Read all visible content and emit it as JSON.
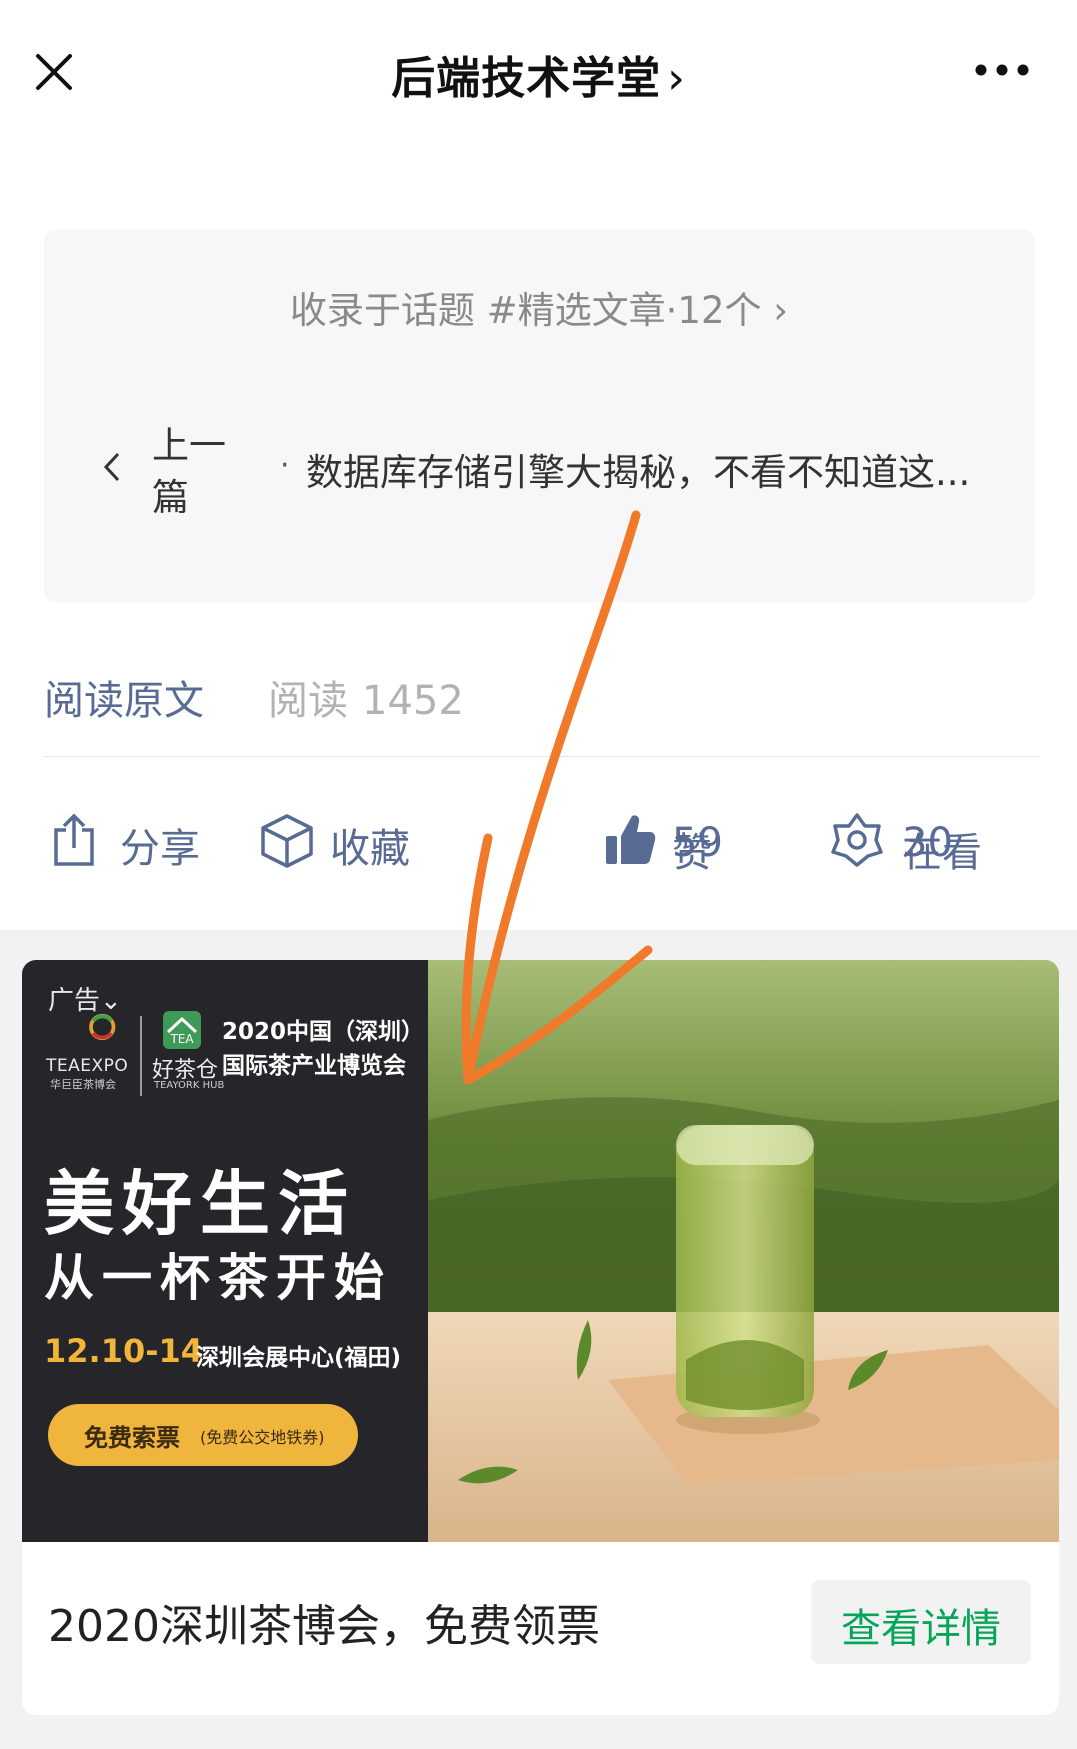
{
  "header": {
    "title": "后端技术学堂",
    "title_chevron": "›"
  },
  "topic_card": {
    "topic_line": "收录于话题 #精选文章·12个 ›",
    "prev_label": "上一篇",
    "prev_dot": "·",
    "prev_title": "数据库存储引擎大揭秘，不看不知道这..."
  },
  "read_row": {
    "read_original": "阅读原文",
    "read_label": "阅读",
    "read_count": "1452"
  },
  "actions": {
    "share_label": "分享",
    "favorite_label": "收藏",
    "like_label": "赞",
    "like_count": "59",
    "wow_label": "在看",
    "wow_count": "30"
  },
  "ad": {
    "tag": "广告",
    "teaexpo_name": "TEAEXPO",
    "teaexpo_sub": "华巨臣茶博会",
    "haochacang_name": "好茶仓",
    "haochacang_sub": "TEAYORK HUB",
    "expo_title_line1": "2020中国（深圳）",
    "expo_title_line2": "国际茶产业博览会",
    "slogan_line1": "美好生活",
    "slogan_line2": "从一杯茶开始",
    "event_date": "12.10-14",
    "event_venue": "深圳会展中心(福田)",
    "ticket_main": "免费索票",
    "ticket_sub": "(免费公交地铁券)",
    "caption": "2020深圳茶博会，免费领票",
    "detail_button": "查看详情"
  },
  "colors": {
    "link_blue": "#576b95",
    "detail_green": "#07a55a",
    "annotation_orange": "#f07a2a",
    "ticket_yellow": "#f0b53d"
  }
}
